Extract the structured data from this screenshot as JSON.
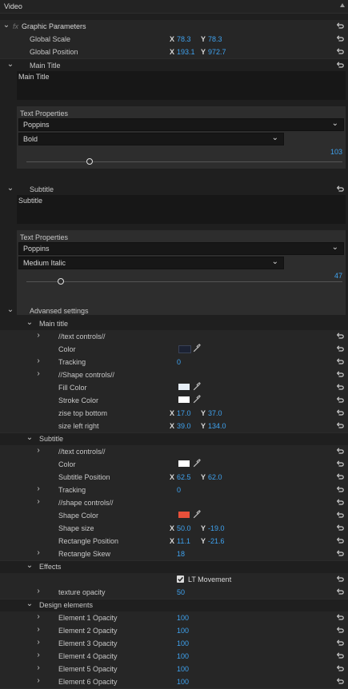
{
  "panel_title": "Video",
  "fx": {
    "symbol": "fx",
    "name": "Graphic Parameters"
  },
  "global_scale": {
    "label": "Global Scale",
    "x": "78.3",
    "y": "78.3"
  },
  "global_position": {
    "label": "Global Position",
    "x": "193.1",
    "y": "972.7"
  },
  "axis": {
    "x": "X",
    "y": "Y"
  },
  "main_title": {
    "section": "Main Title",
    "text": "Main Title",
    "props_label": "Text Properties",
    "font": "Poppins",
    "style": "Bold",
    "size": "103",
    "size_fraction": 0.2
  },
  "subtitle": {
    "section": "Subtitle",
    "text": "Subtitle",
    "props_label": "Text Properties",
    "font": "Poppins",
    "style": "Medium Italic",
    "size": "47",
    "size_fraction": 0.11
  },
  "advanced": {
    "section": "Advansed settings",
    "main_title_group": "Main title",
    "text_controls": "//text controls//",
    "color": "Color",
    "tracking": "Tracking",
    "tracking_value": "0",
    "shape_controls": "//Shape controls//",
    "fill_color": "Fill Color",
    "stroke_color": "Stroke Color",
    "zise_top_bottom": {
      "label": "zise top bottom",
      "x": "17.0",
      "y": "37.0"
    },
    "size_left_right": {
      "label": "size left right",
      "x": "39.0",
      "y": "134.0"
    },
    "subtitle_group": "Subtitle",
    "sub_text_controls": "//text controls//",
    "sub_color": "Color",
    "subtitle_position": {
      "label": "Subtitle Position",
      "x": "62.5",
      "y": "62.0"
    },
    "sub_tracking": "Tracking",
    "sub_tracking_value": "0",
    "sub_shape_controls": "//shape controls//",
    "shape_color": "Shape Color",
    "shape_size": {
      "label": "Shape size",
      "x": "50.0",
      "y": "-19.0"
    },
    "rectangle_position": {
      "label": "Rectangle Position",
      "x": "11.1",
      "y": "-21.6"
    },
    "rectangle_skew": {
      "label": "Rectangle Skew",
      "value": "18"
    },
    "effects_group": "Effects",
    "lt_movement": "LT Movement",
    "texture_opacity": {
      "label": "texture opacity",
      "value": "50"
    },
    "design_elements": "Design elements",
    "elements": [
      {
        "label": "Element 1 Opacity",
        "value": "100"
      },
      {
        "label": "Element 2 Opacity",
        "value": "100"
      },
      {
        "label": "Element 3 Opacity",
        "value": "100"
      },
      {
        "label": "Element 4 Opacity",
        "value": "100"
      },
      {
        "label": "Element 5 Opacity",
        "value": "100"
      },
      {
        "label": "Element 6 Opacity",
        "value": "100"
      }
    ]
  },
  "colors": {
    "accent_value": "#3fa3f0",
    "main_text_color": "#1c2233",
    "fill_color": "#e6eef6",
    "stroke_color": "#ffffff",
    "sub_color": "#ffffff",
    "shape_color": "#e8503a"
  },
  "icons": {
    "reset": "reset-icon",
    "eyedropper": "eyedropper-icon",
    "chevron": "chevron-icon"
  }
}
